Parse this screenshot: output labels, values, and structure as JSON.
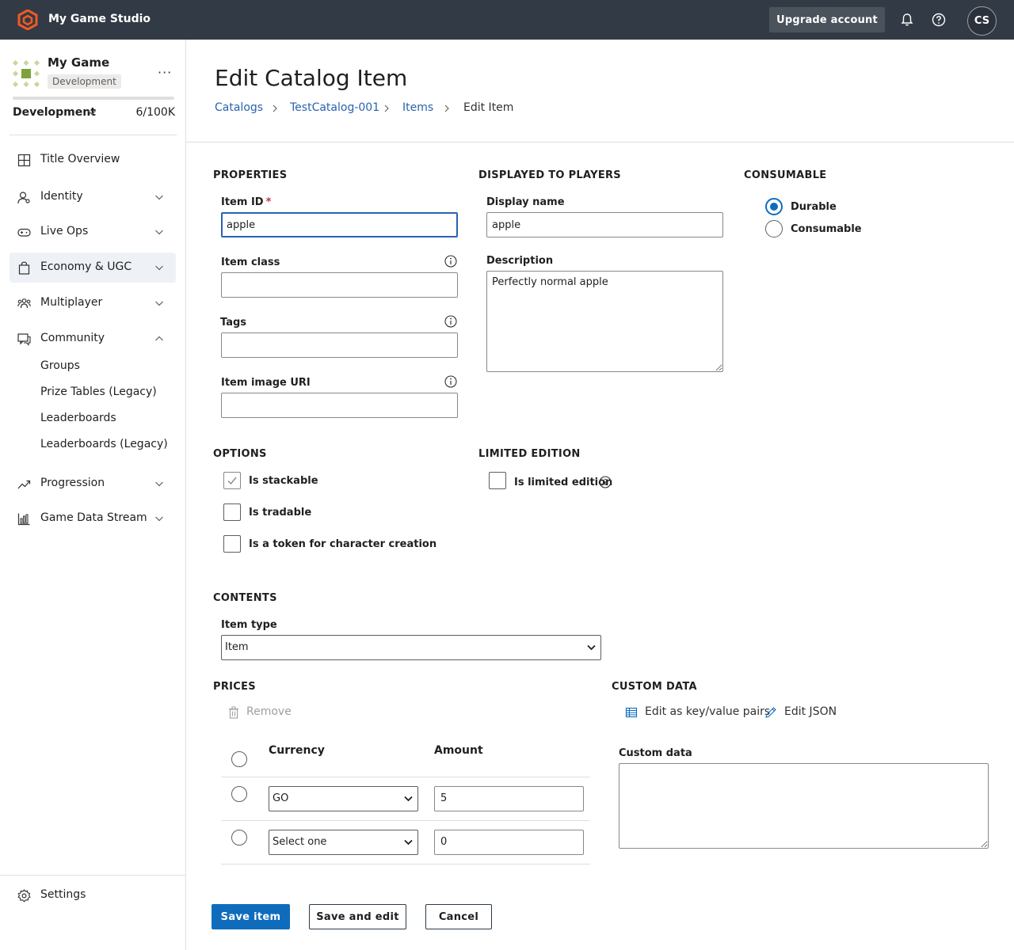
{
  "topbar": {
    "studio_name": "My Game Studio",
    "upgrade_label": "Upgrade account",
    "user_initials": "CS"
  },
  "sidebar": {
    "game_name": "My Game",
    "environment_badge": "Development",
    "more_label": "···",
    "environment_select": "Development",
    "usage": "6/100K",
    "usage_fraction": 6e-05,
    "nav": [
      {
        "label": "Title Overview",
        "icon": "grid-icon"
      },
      {
        "label": "Identity",
        "icon": "identity-icon",
        "expandable": true
      },
      {
        "label": "Live Ops",
        "icon": "gamepad-icon",
        "expandable": true
      },
      {
        "label": "Economy & UGC",
        "icon": "bag-icon",
        "expandable": true,
        "active": true
      },
      {
        "label": "Multiplayer",
        "icon": "people-icon",
        "expandable": true
      },
      {
        "label": "Community",
        "icon": "chat-icon",
        "expanded": true
      },
      {
        "label": "Progression",
        "icon": "trend-icon",
        "expandable": true
      },
      {
        "label": "Game Data Stream",
        "icon": "bar-chart-icon",
        "expandable": true
      }
    ],
    "community_sub": [
      "Groups",
      "Prize Tables (Legacy)",
      "Leaderboards",
      "Leaderboards (Legacy)"
    ],
    "settings_label": "Settings"
  },
  "page": {
    "title": "Edit Catalog Item",
    "breadcrumb": [
      "Catalogs",
      "TestCatalog-001",
      "Items",
      "Edit Item"
    ]
  },
  "properties": {
    "heading": "PROPERTIES",
    "item_id_label": "Item ID",
    "item_id_required": "*",
    "item_id_value": "apple",
    "item_class_label": "Item class",
    "item_class_value": "",
    "tags_label": "Tags",
    "tags_value": "",
    "image_uri_label": "Item image URI",
    "image_uri_value": ""
  },
  "displayed": {
    "heading": "DISPLAYED TO PLAYERS",
    "display_name_label": "Display name",
    "display_name_value": "apple",
    "description_label": "Description",
    "description_value": "Perfectly normal apple"
  },
  "consumable": {
    "heading": "CONSUMABLE",
    "options": [
      "Durable",
      "Consumable"
    ],
    "selected": "Durable"
  },
  "options": {
    "heading": "OPTIONS",
    "items": [
      {
        "label": "Is stackable",
        "checked": true
      },
      {
        "label": "Is tradable",
        "checked": false
      },
      {
        "label": "Is a token for character creation",
        "checked": false
      }
    ]
  },
  "limited": {
    "heading": "LIMITED EDITION",
    "label": "Is limited edition",
    "checked": false
  },
  "contents": {
    "heading": "CONTENTS",
    "item_type_label": "Item type",
    "item_type_value": "Item"
  },
  "prices": {
    "heading": "PRICES",
    "remove_label": "Remove",
    "col_currency": "Currency",
    "col_amount": "Amount",
    "rows": [
      {
        "currency": "GO",
        "amount": "5"
      },
      {
        "currency": "Select one",
        "amount": "0"
      }
    ]
  },
  "custom_data": {
    "heading": "CUSTOM DATA",
    "edit_kv_label": "Edit as key/value pairs",
    "edit_json_label": "Edit JSON",
    "field_label": "Custom data",
    "value": ""
  },
  "footer": {
    "save_label": "Save item",
    "save_edit_label": "Save and edit",
    "cancel_label": "Cancel"
  },
  "colors": {
    "topbar": "#323a45",
    "accent": "#0f6cbd",
    "link": "#2a62b0",
    "logo_orange": "#f05a22",
    "game_green": "#7ea33b"
  }
}
